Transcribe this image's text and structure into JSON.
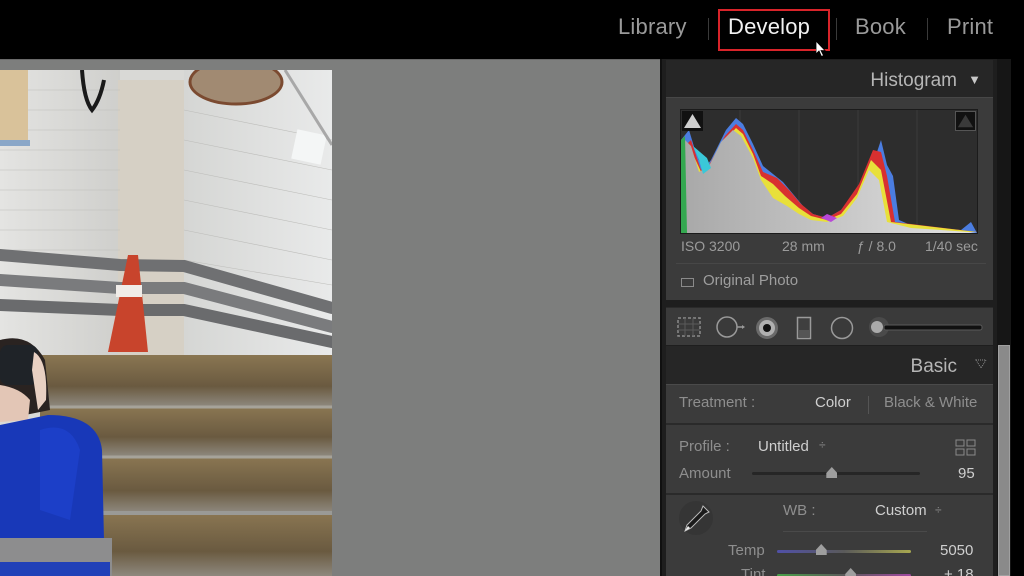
{
  "topbar": {
    "modules": [
      {
        "label": "Library",
        "active": false
      },
      {
        "label": "Develop",
        "active": true
      },
      {
        "label": "Book",
        "active": false
      },
      {
        "label": "Print",
        "active": false
      }
    ],
    "highlight_color": "#d8242a"
  },
  "histogram": {
    "title": "Histogram",
    "toggle_icon": "triangle-down-icon",
    "exif": {
      "iso": "ISO 3200",
      "focal_length": "28 mm",
      "aperture": "ƒ / 8.0",
      "shutter": "1/40 sec"
    },
    "original_photo_label": "Original Photo"
  },
  "tools": [
    "crop-overlay-icon",
    "spot-removal-icon",
    "red-eye-icon",
    "graduated-filter-icon",
    "radial-filter-icon",
    "adjustment-brush-icon"
  ],
  "basic": {
    "title": "Basic",
    "treatment_label": "Treatment :",
    "treatment_options": [
      "Color",
      "Black & White"
    ],
    "treatment_selected": "Color",
    "profile_label": "Profile :",
    "profile_value": "Untitled",
    "profile_stepper": "÷",
    "amount_label": "Amount",
    "amount_value": "95",
    "amount_fraction": 0.475,
    "wb_label": "WB :",
    "wb_value": "Custom",
    "wb_stepper": "÷",
    "temp_label": "Temp",
    "temp_value": "5050",
    "temp_fraction": 0.33,
    "tint_label": "Tint",
    "tint_value": "+ 18",
    "tint_fraction": 0.55
  }
}
